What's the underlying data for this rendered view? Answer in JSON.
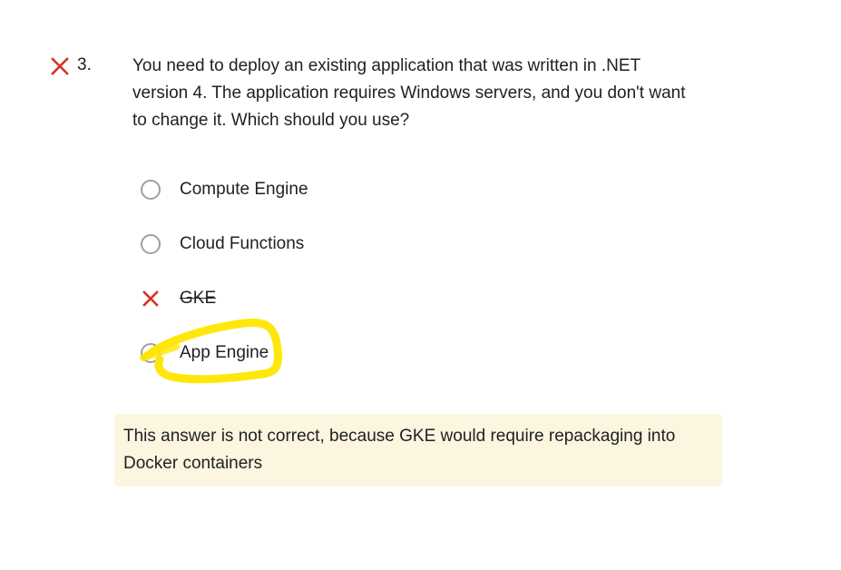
{
  "question": {
    "status_icon": "close-icon",
    "status_color": "#d93025",
    "number": "3.",
    "text": "You need to deploy an existing application that was written in .NET version 4. The application requires Windows servers, and you don't want to change it. Which should you use?"
  },
  "options": [
    {
      "label": "Compute Engine",
      "state": "unselected",
      "icon": "radio-unchecked-icon"
    },
    {
      "label": "Cloud Functions",
      "state": "unselected",
      "icon": "radio-unchecked-icon"
    },
    {
      "label": "GKE",
      "state": "selected-incorrect",
      "icon": "close-icon",
      "struck": true
    },
    {
      "label": "App Engine",
      "state": "unselected",
      "icon": "radio-unchecked-icon",
      "annotation": "yellow-highlighter-circle"
    }
  ],
  "feedback": {
    "text": "This answer is not correct, because GKE would require repackaging into Docker containers",
    "background": "#fcf5e0"
  },
  "colors": {
    "incorrect": "#d93025",
    "highlighter": "#ffe600",
    "radio_border": "#9aa0a6"
  }
}
